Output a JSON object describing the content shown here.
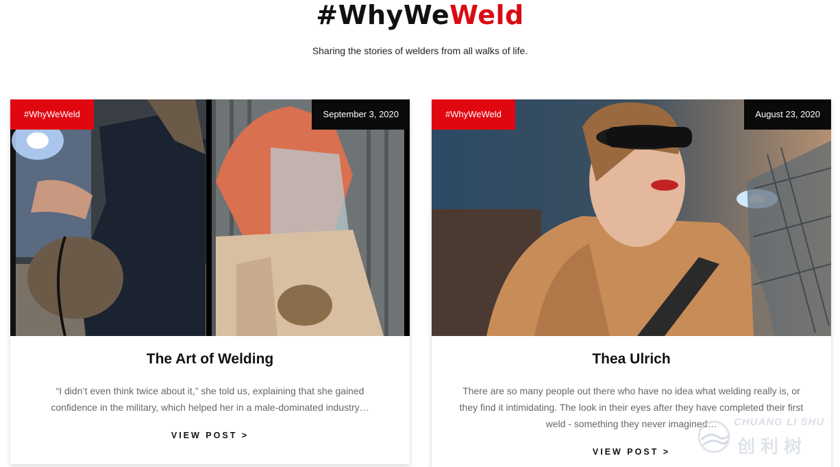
{
  "hero": {
    "title_main": "#WhyWe",
    "title_accent": "Weld",
    "subtitle": "Sharing the stories of welders from all walks of life."
  },
  "posts": [
    {
      "tag": "#WhyWeWeld",
      "date": "September 3, 2020",
      "title": "The Art of Welding",
      "excerpt": "“I didn’t even think twice about it,” she told us, explaining that she gained confidence in the military, which helped her in a male-dominated industry…",
      "cta": "VIEW POST >"
    },
    {
      "tag": "#WhyWeWeld",
      "date": "August 23, 2020",
      "title": "Thea Ulrich",
      "excerpt": "There are so many people out there who have no idea what welding really is, or they find it intimidating. The look in their eyes after they have completed their first weld - something they never imagined…",
      "cta": "VIEW POST >"
    }
  ],
  "watermark": {
    "latin": "CHUANG LI SHU",
    "cjk": "创利树"
  },
  "colors": {
    "accent": "#d90b14",
    "tag_bg": "#e10711",
    "date_bg": "#0a0a0a"
  }
}
